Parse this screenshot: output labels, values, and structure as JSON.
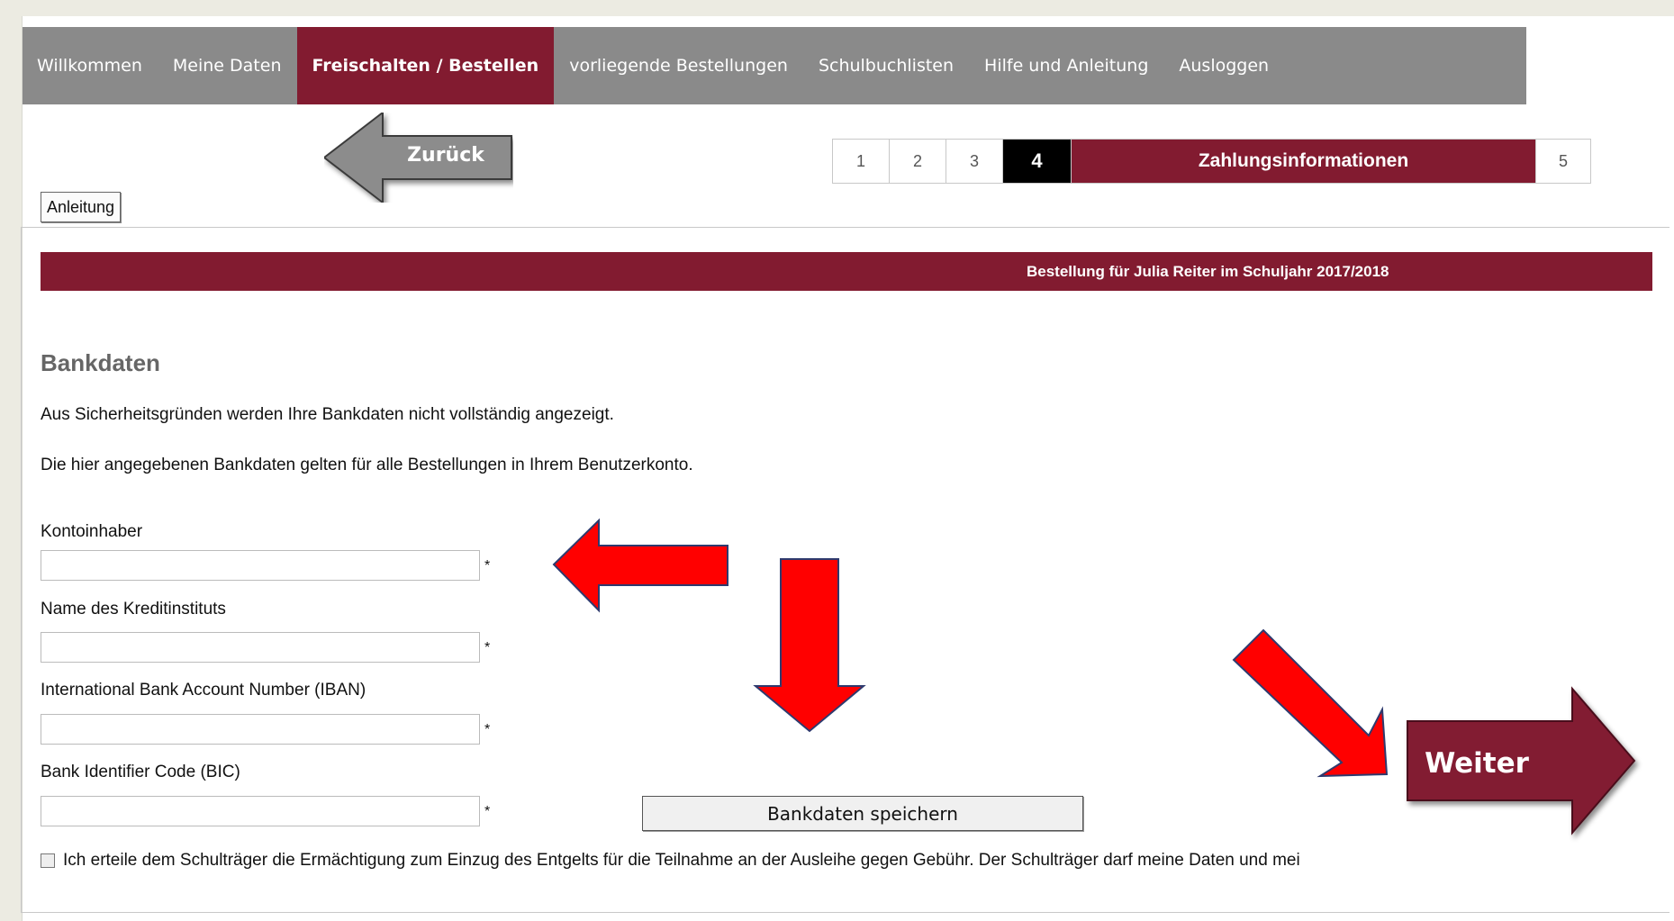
{
  "nav": {
    "items": [
      {
        "label": "Willkommen"
      },
      {
        "label": "Meine Daten"
      },
      {
        "label": "Freischalten / Bestellen"
      },
      {
        "label": "vorliegende Bestellungen"
      },
      {
        "label": "Schulbuchlisten"
      },
      {
        "label": "Hilfe und Anleitung"
      },
      {
        "label": "Ausloggen"
      }
    ],
    "active_index": 2
  },
  "back_button": {
    "label": "Zurück"
  },
  "stepper": {
    "steps": [
      "1",
      "2",
      "3"
    ],
    "current": "4",
    "current_label": "Zahlungsinformationen",
    "next": "5"
  },
  "help_button": {
    "label": "Anleitung"
  },
  "order_bar": {
    "text": "Bestellung für Julia Reiter im Schuljahr 2017/2018"
  },
  "bank": {
    "heading": "Bankdaten",
    "security_note": "Aus Sicherheitsgründen werden Ihre Bankdaten nicht vollständig angezeigt.",
    "scope_note": "Die hier angegebenen Bankdaten gelten für alle Bestellungen in Ihrem Benutzerkonto.",
    "fields": [
      {
        "label": "Kontoinhaber",
        "value": "",
        "required_mark": "*"
      },
      {
        "label": "Name des Kreditinstituts",
        "value": "",
        "required_mark": "*"
      },
      {
        "label": "International Bank Account Number (IBAN)",
        "value": "",
        "required_mark": "*"
      },
      {
        "label": "Bank Identifier Code (BIC)",
        "value": "",
        "required_mark": "*"
      }
    ],
    "save_label": "Bankdaten speichern",
    "consent_text": "Ich erteile dem Schulträger die Ermächtigung zum Einzug des Entgelts für die Teilnahme an der Ausleihe gegen Gebühr. Der Schulträger darf meine Daten und mei"
  },
  "next_button": {
    "label": "Weiter"
  },
  "colors": {
    "brand": "#821b30",
    "nav_bg": "#8a8a8a",
    "annotation_arrow": "#ff0000",
    "back_arrow": "#8c8c8c"
  }
}
